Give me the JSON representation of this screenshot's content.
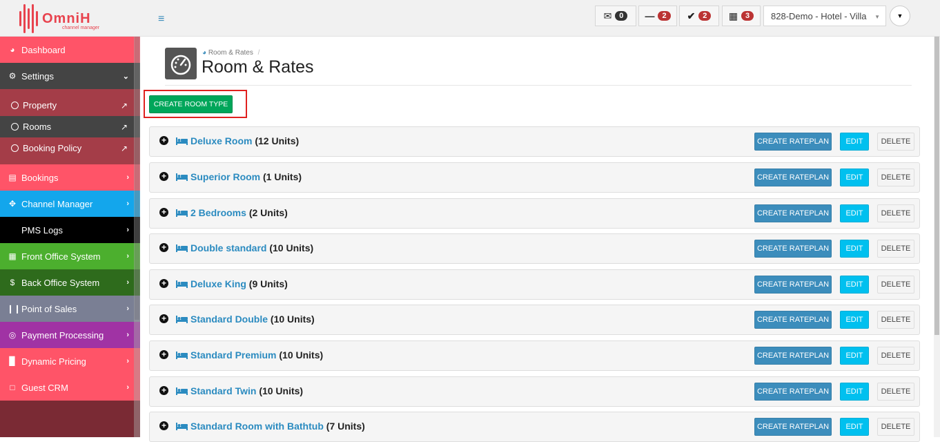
{
  "brand": {
    "name": "OmniH",
    "tagline": "channel manager",
    "color": "#e8434e"
  },
  "topbar": {
    "menu_icon": "hamburger-icon",
    "badges": [
      {
        "icon": "envelope-open-icon",
        "count": "0"
      },
      {
        "icon": "minus-icon",
        "count": "2"
      },
      {
        "icon": "check-icon",
        "count": "2"
      },
      {
        "icon": "calendar-icon",
        "count": "3"
      }
    ],
    "hotel": "828-Demo - Hotel - Villa",
    "user_menu_icon": "caret-down-icon"
  },
  "sidebar": {
    "items": [
      {
        "label": "Dashboard",
        "icon": "dashboard-icon",
        "color": "#ff5468"
      },
      {
        "label": "Settings",
        "icon": "gear-icon",
        "color": "#444444"
      },
      {
        "label": "Bookings",
        "icon": "list-icon",
        "color": "#ff5468"
      },
      {
        "label": "Channel Manager",
        "icon": "arrows-icon",
        "color": "#13a6ec"
      },
      {
        "label": "PMS Logs",
        "icon": "",
        "color": "#000000"
      },
      {
        "label": "Front Office System",
        "icon": "calendar-icon",
        "color": "#4caf2e"
      },
      {
        "label": "Back Office System",
        "icon": "dollar-icon",
        "color": "#2e6b1c"
      },
      {
        "label": "Point of Sales",
        "icon": "cutlery-icon",
        "color": "#7a7f94"
      },
      {
        "label": "Payment Processing",
        "icon": "target-icon",
        "color": "#a033a4"
      },
      {
        "label": "Dynamic Pricing",
        "icon": "bar-chart-icon",
        "color": "#ff5468"
      },
      {
        "label": "Guest CRM",
        "icon": "file-icon",
        "color": "#ff5468"
      }
    ],
    "settings_sub": [
      {
        "label": "Property"
      },
      {
        "label": "Rooms"
      },
      {
        "label": "Booking Policy"
      }
    ]
  },
  "page": {
    "breadcrumb": "Room & Rates",
    "breadcrumb_sep": "/",
    "title": "Room & Rates",
    "create_room_type_label": "CREATE ROOM TYPE"
  },
  "rooms": [
    {
      "name": "Deluxe Room",
      "units": "(12 Units)"
    },
    {
      "name": "Superior Room",
      "units": "(1 Units)"
    },
    {
      "name": "2 Bedrooms",
      "units": "(2 Units)"
    },
    {
      "name": "Double standard",
      "units": "(10 Units)"
    },
    {
      "name": "Deluxe King",
      "units": "(9 Units)"
    },
    {
      "name": "Standard Double",
      "units": "(10 Units)"
    },
    {
      "name": "Standard Premium",
      "units": "(10 Units)"
    },
    {
      "name": "Standard Twin",
      "units": "(10 Units)"
    },
    {
      "name": "Standard Room with Bathtub",
      "units": "(7 Units)"
    }
  ],
  "row_buttons": {
    "create_rateplan": "CREATE RATEPLAN",
    "edit": "EDIT",
    "delete": "DELETE"
  }
}
